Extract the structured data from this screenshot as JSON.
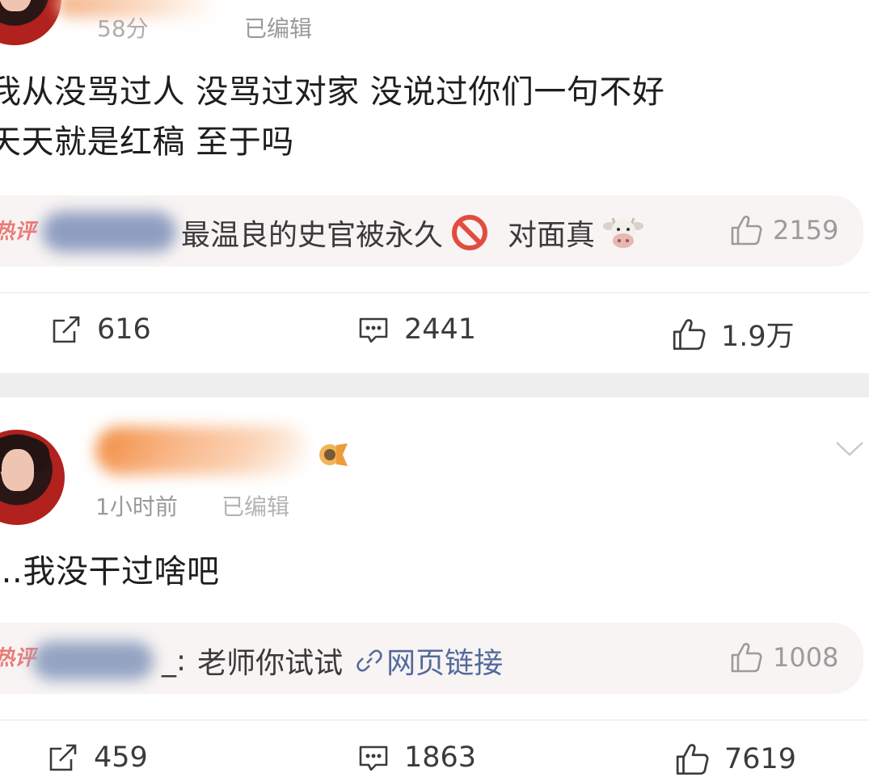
{
  "post1": {
    "meta_time": "58分",
    "meta_edited": "已编辑",
    "lines": [
      "我从没骂过人 没骂过对家 没说过你们一句不好",
      "天天就是红稿 至于吗"
    ],
    "hot_comment": {
      "tag": "热评",
      "text": "最温良的史官被永久",
      "text_after": "对面真",
      "likes": "2159"
    },
    "actions": {
      "share": "616",
      "comment": "2441",
      "like": "1.9万"
    }
  },
  "post2": {
    "meta_time": "1小时前",
    "meta_edited": "已编辑",
    "lines": [
      "…我没干过啥吧"
    ],
    "hot_comment": {
      "tag": "热评",
      "name_suffix": "_:",
      "text": "老师你试试",
      "link_text": "网页链接",
      "likes": "1008"
    },
    "actions": {
      "share": "459",
      "comment": "1863",
      "like": "7619"
    }
  },
  "icons": {
    "share": "share-icon",
    "comment": "comment-icon",
    "like": "thumbs-up-icon",
    "forbidden": "prohibited-icon",
    "cow": "cow-face-icon",
    "chain": "link-icon",
    "more": "chevron-down-icon",
    "badge": "vip-badge-icon"
  },
  "colors": {
    "accent_hot": "#e8534e",
    "link": "#536a9c",
    "username_orange": "#f09a5a"
  }
}
